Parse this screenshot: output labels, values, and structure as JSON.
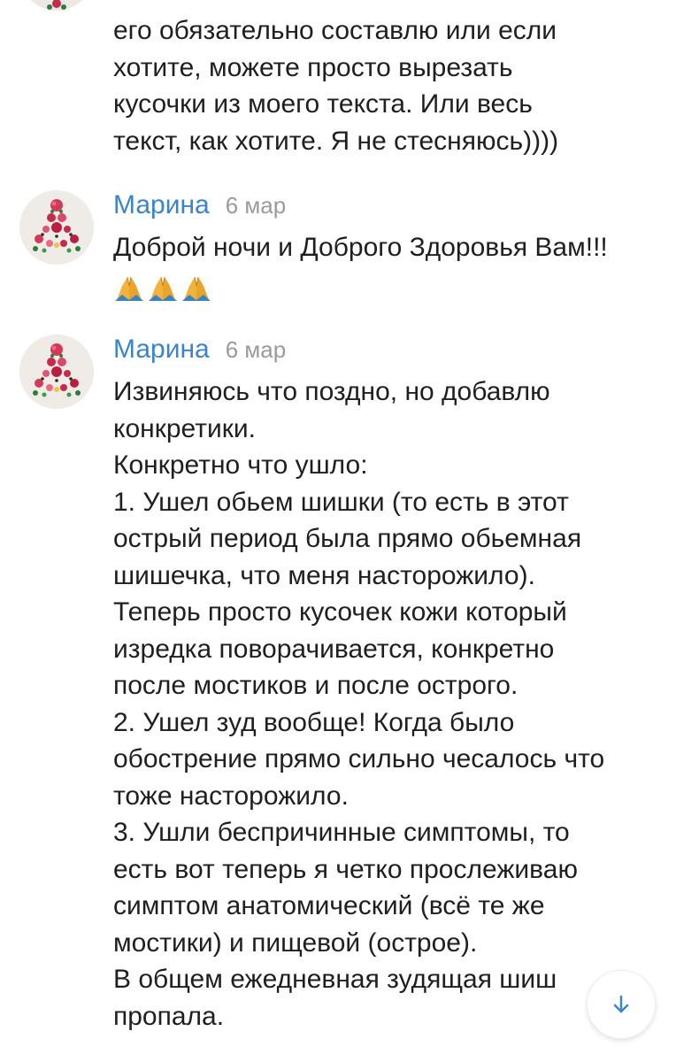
{
  "previous_comment": {
    "lines": [
      "его обязательно составлю или если",
      "хотите, можете просто вырезать",
      "кусочки из моего текста. Или весь",
      "текст, как хотите. Я не стесняюсь))))"
    ]
  },
  "comments": [
    {
      "author": "Марина",
      "date": "6 мар",
      "lines": [
        "Доброй ночи и Доброго Здоровья Вам!!!"
      ],
      "emoji": [
        "folded-hands-icon",
        "folded-hands-icon",
        "folded-hands-icon"
      ]
    },
    {
      "author": "Марина",
      "date": "6 мар",
      "lines": [
        "Извиняюсь что поздно, но добавлю",
        "конкретики.",
        "Конкретно что ушло:",
        "1. Ушел обьем шишки (то есть в этот",
        "острый период была прямо обьемная",
        "шишечка, что меня насторожило).",
        "Теперь просто кусочек кожи который",
        "изредка поворачивается, конкретно",
        "после мостиков и после острого.",
        "2. Ушел зуд вообще! Когда было",
        "обострение прямо сильно чесалось что",
        "тоже насторожило.",
        "3. Ушли беспричинные симптомы, то",
        "есть вот теперь я четко прослеживаю",
        "симптом анатомический (всё те же",
        "мостики) и пищевой (острое).",
        "В общем ежедневная зудящая шиш",
        "пропала."
      ]
    }
  ],
  "colors": {
    "author": "#3a85c8",
    "date": "#9a9a9a",
    "text": "#1f1f1f"
  },
  "scroll_button_icon": "arrow-down-icon"
}
